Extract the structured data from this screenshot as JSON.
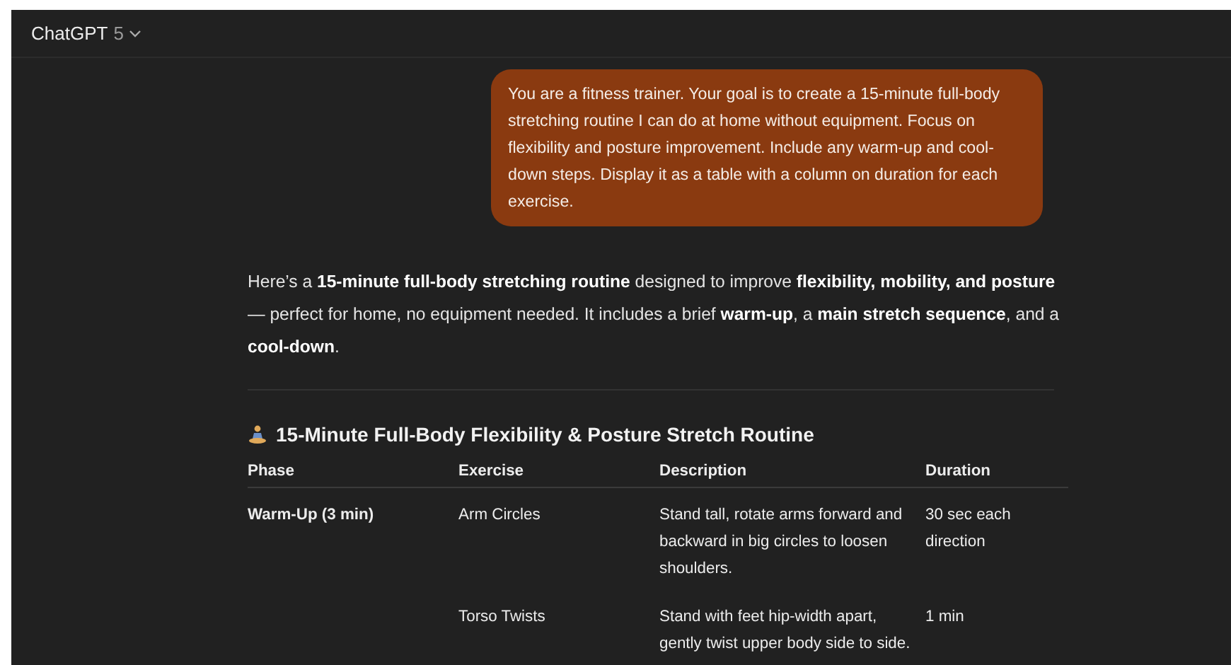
{
  "header": {
    "model": "ChatGPT",
    "version": "5"
  },
  "user_message": "You are a fitness trainer. Your goal is to create a 15-minute full-body stretching routine I can do at home without equipment. Focus on flexibility and posture improvement. Include any warm-up and cool-down steps. Display it as a table with a column on duration for each exercise.",
  "answer": {
    "intro": "Here’s a **15-minute full-body stretching routine** designed to improve **flexibility, mobility, and posture** — perfect for home, no equipment needed. It includes a brief **warm-up**, a **main stretch sequence**, and a **cool-down**.",
    "heading": "15-Minute Full-Body Flexibility & Posture Stretch Routine",
    "table": {
      "columns": [
        "Phase",
        "Exercise",
        "Description",
        "Duration"
      ],
      "rows": [
        {
          "phase": "Warm-Up (3 min)",
          "exercise": "Arm Circles",
          "description": "Stand tall, rotate arms forward and backward in big circles to loosen shoulders.",
          "duration": "30 sec each direction"
        },
        {
          "exercise": "Torso Twists",
          "description": "Stand with feet hip-width apart, gently twist upper body side to side.",
          "duration": "1 min"
        }
      ]
    }
  }
}
